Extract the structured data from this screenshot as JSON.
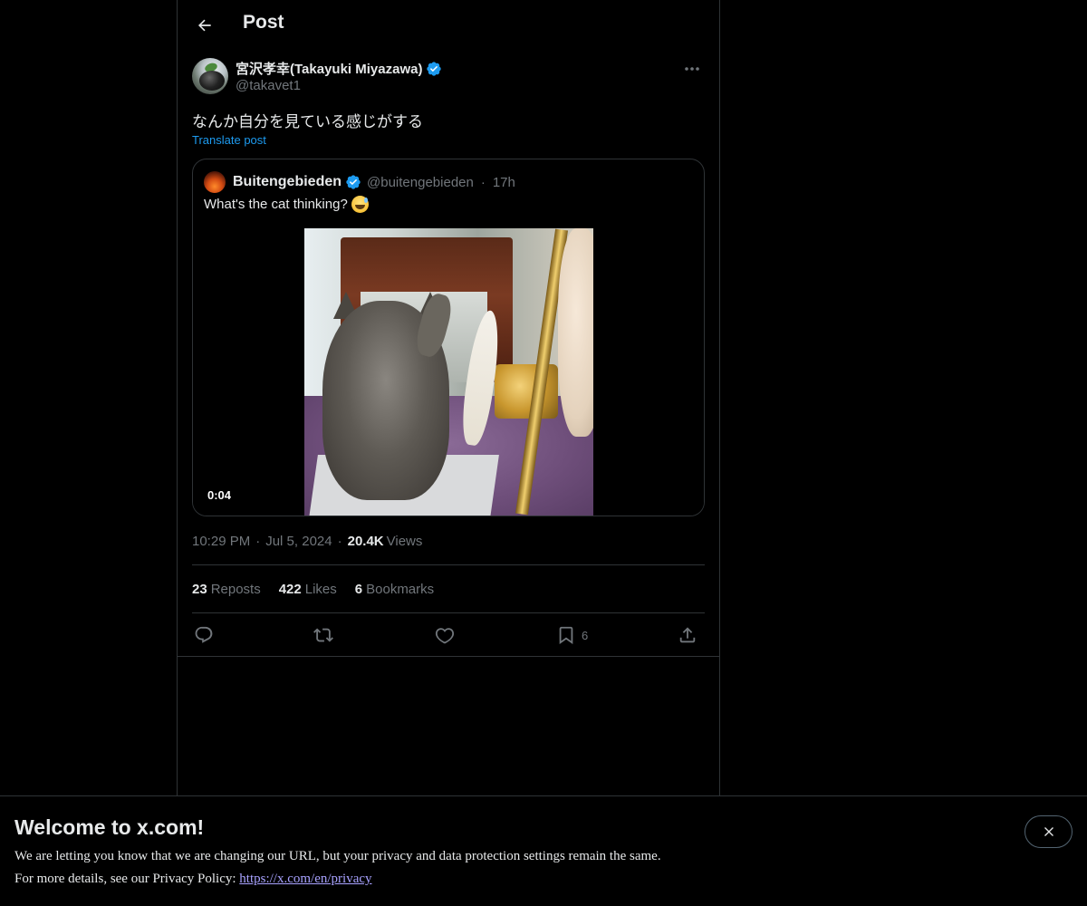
{
  "header": {
    "title": "Post"
  },
  "author": {
    "name": "宮沢孝幸(Takayuki Miyazawa)",
    "handle": "@takavet1"
  },
  "post": {
    "text": "なんか自分を見ている感じがする",
    "translate_label": "Translate post"
  },
  "quote": {
    "name": "Buitengebieden",
    "handle": "@buitengebieden",
    "separator": "·",
    "time": "17h",
    "text": "What's the cat thinking?",
    "video_duration": "0:04"
  },
  "meta": {
    "time": "10:29 PM",
    "dot1": "·",
    "date": "Jul 5, 2024",
    "dot2": "·",
    "views_count": "20.4K",
    "views_label": "Views"
  },
  "stats": {
    "reposts_count": "23",
    "reposts_label": "Reposts",
    "likes_count": "422",
    "likes_label": "Likes",
    "bookmarks_count": "6",
    "bookmarks_label": "Bookmarks"
  },
  "actions": {
    "bookmark_count": "6"
  },
  "banner": {
    "title": "Welcome to x.com!",
    "line1": "We are letting you know that we are changing our URL, but your privacy and data protection settings remain the same.",
    "line2_prefix": "For more details, see our Privacy Policy: ",
    "link": "https://x.com/en/privacy"
  },
  "colors": {
    "background": "#000000",
    "text": "#e7e9ea",
    "muted": "#71767b",
    "accent": "#1d9bf0",
    "border": "#2f3336",
    "link": "#a8a2ff"
  }
}
